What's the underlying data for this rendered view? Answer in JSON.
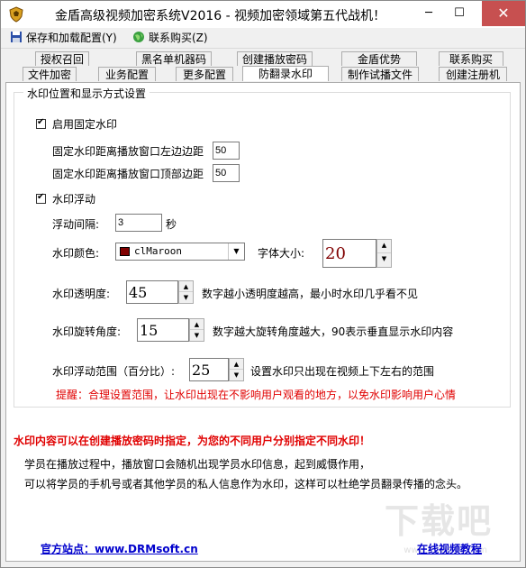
{
  "window": {
    "title": "金盾高级视频加密系统V2016 - 视频加密领域第五代战机！",
    "min": "─",
    "max": "☐",
    "close": "✕"
  },
  "menu": {
    "save_load": "保存和加载配置(Y)",
    "contact_buy": "联系购买(Z)"
  },
  "tabs_row1": [
    "授权召回",
    "黑名单机器码",
    "创建播放密码",
    "金盾优势",
    "联系购买"
  ],
  "tabs_row2": [
    "文件加密",
    "业务配置",
    "更多配置",
    "防翻录水印",
    "制作试播文件",
    "创建注册机"
  ],
  "group": {
    "title": "水印位置和显示方式设置",
    "enable_fixed": "启用固定水印",
    "left_margin_label": "固定水印距离播放窗口左边边距",
    "left_margin_value": "50",
    "top_margin_label": "固定水印距离播放窗口顶部边距",
    "top_margin_value": "50",
    "float_enable": "水印浮动",
    "float_interval_label": "浮动间隔:",
    "float_interval_value": "3",
    "float_interval_unit": "秒",
    "color_label": "水印颜色:",
    "color_value": "clMaroon",
    "font_size_label": "字体大小:",
    "font_size_value": "20",
    "transparency_label": "水印透明度:",
    "transparency_value": "45",
    "transparency_hint": "数字越小透明度越高，最小时水印几乎看不见",
    "rotation_label": "水印旋转角度:",
    "rotation_value": "15",
    "rotation_hint": "数字越大旋转角度越大，90表示垂直显示水印内容",
    "range_label": "水印浮动范围（百分比）:",
    "range_value": "25",
    "range_hint": "设置水印只出现在视频上下左右的范围",
    "reminder": "提醒：合理设置范围，让水印出现在不影响用户观看的地方，以免水印影响用户心情"
  },
  "notes": {
    "highlight": "水印内容可以在创建播放密码时指定，为您的不同用户分别指定不同水印！",
    "line1": "学员在播放过程中，播放窗口会随机出现学员水印信息，起到威慑作用，",
    "line2": "可以将学员的手机号或者其他学员的私人信息作为水印，这样可以杜绝学员翻录传播的念头。"
  },
  "footer": {
    "site": "官方站点：www.DRMsoft.cn",
    "tutorial": "在线视频教程"
  },
  "watermark": {
    "main": "下载吧",
    "sub": "www.xiazaiba.com"
  },
  "colors": {
    "swatch": "#800000",
    "warning": "#e00000",
    "link": "#0000cc"
  }
}
